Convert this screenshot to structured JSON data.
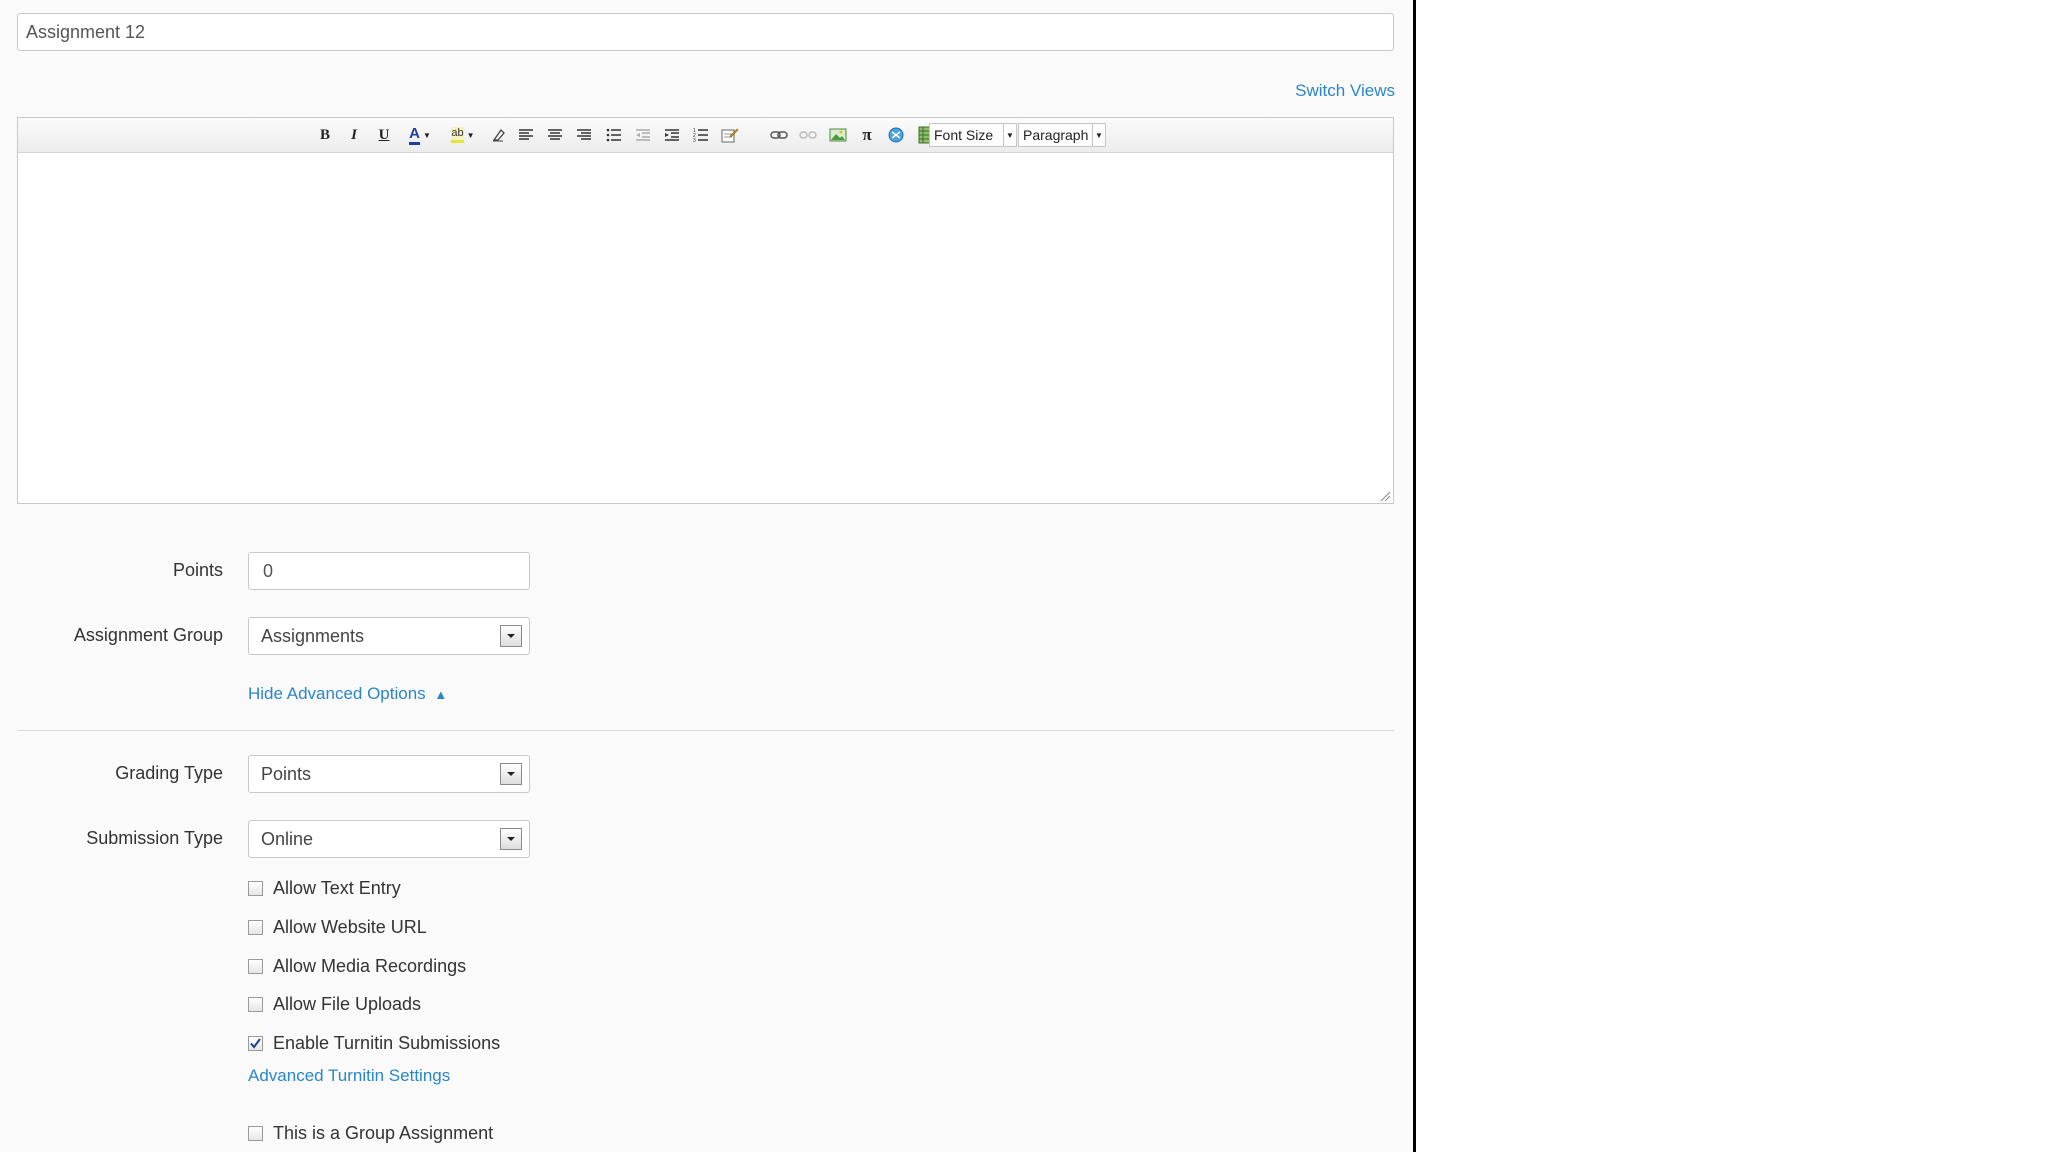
{
  "assignment": {
    "title_value": "Assignment 12"
  },
  "editor": {
    "switch_views_label": "Switch Views",
    "font_size_label": "Font Size",
    "paragraph_label": "Paragraph",
    "toolbar_icons": [
      "bold-icon",
      "italic-icon",
      "underline-icon",
      "text-color-icon",
      "highlight-icon",
      "clear-format-icon",
      "align-left-icon",
      "align-center-icon",
      "align-right-icon",
      "bullet-list-icon",
      "outdent-icon",
      "indent-icon",
      "numbered-list-icon",
      "embed-icon",
      "link-icon",
      "unlink-icon",
      "image-icon",
      "math-icon",
      "media-icon",
      "table-icon"
    ],
    "bold": "B",
    "italic": "I",
    "underline": "U",
    "text_color": "A",
    "math": "π",
    "highlight": "ab"
  },
  "form": {
    "points": {
      "label": "Points",
      "value": "0"
    },
    "assignment_group": {
      "label": "Assignment Group",
      "value": "Assignments"
    },
    "advanced_toggle": {
      "label": "Hide Advanced Options",
      "arrow": "▲"
    },
    "grading_type": {
      "label": "Grading Type",
      "value": "Points"
    },
    "submission_type": {
      "label": "Submission Type",
      "value": "Online"
    },
    "options": [
      {
        "label": "Allow Text Entry",
        "checked": false
      },
      {
        "label": "Allow Website URL",
        "checked": false
      },
      {
        "label": "Allow Media Recordings",
        "checked": false
      },
      {
        "label": "Allow File Uploads",
        "checked": false
      },
      {
        "label": "Enable Turnitin Submissions",
        "checked": true
      }
    ],
    "turnitin_settings_label": "Advanced Turnitin Settings",
    "group_assignment": {
      "label": "This is a Group Assignment",
      "checked": false
    }
  },
  "colors": {
    "link": "#2a86c7",
    "panel_bg": "#fafafa",
    "border": "#c8c8c8"
  }
}
